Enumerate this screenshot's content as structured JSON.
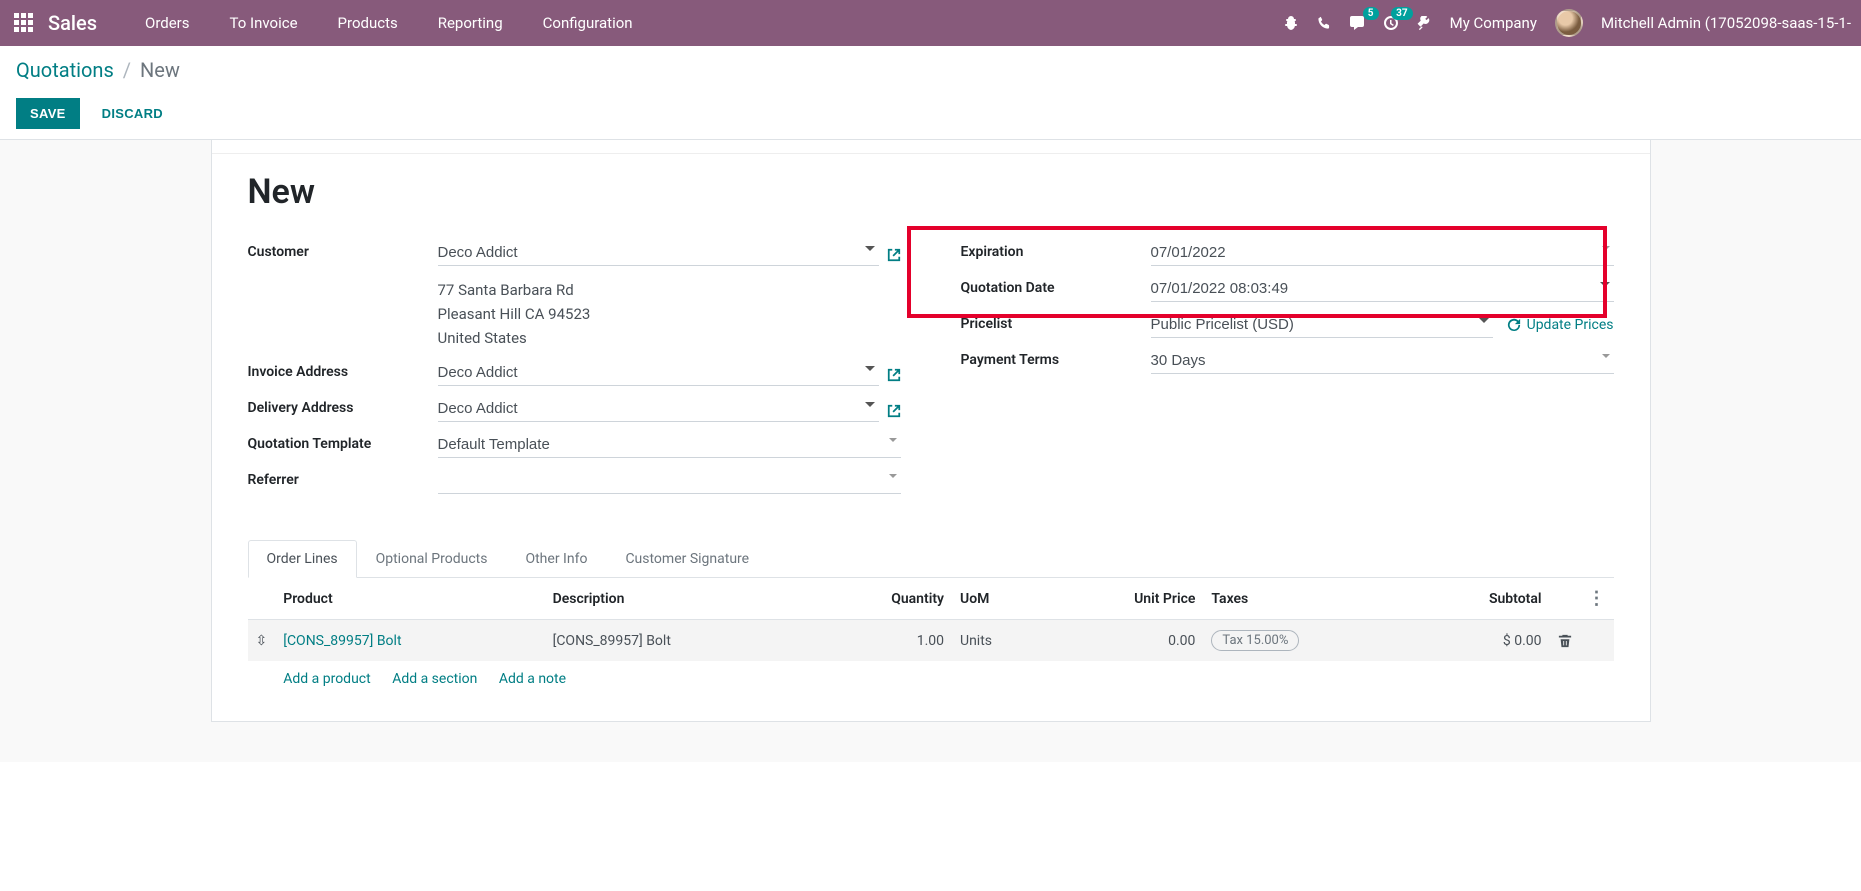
{
  "nav": {
    "brand": "Sales",
    "items": [
      "Orders",
      "To Invoice",
      "Products",
      "Reporting",
      "Configuration"
    ],
    "messaging_badge": "5",
    "activities_badge": "37",
    "company": "My Company",
    "user": "Mitchell Admin (17052098-saas-15-1-"
  },
  "breadcrumb": {
    "root": "Quotations",
    "current": "New"
  },
  "buttons": {
    "save": "SAVE",
    "discard": "DISCARD"
  },
  "title": "New",
  "left": {
    "customer_label": "Customer",
    "customer_value": "Deco Addict",
    "address_line1": "77 Santa Barbara Rd",
    "address_line2": "Pleasant Hill CA 94523",
    "address_line3": "United States",
    "invoice_label": "Invoice Address",
    "invoice_value": "Deco Addict",
    "delivery_label": "Delivery Address",
    "delivery_value": "Deco Addict",
    "template_label": "Quotation Template",
    "template_value": "Default Template",
    "referrer_label": "Referrer",
    "referrer_value": ""
  },
  "right": {
    "expiration_label": "Expiration",
    "expiration_value": "07/01/2022",
    "date_label": "Quotation Date",
    "date_value": "07/01/2022 08:03:49",
    "pricelist_label": "Pricelist",
    "pricelist_value": "Public Pricelist (USD)",
    "update_prices": "Update Prices",
    "terms_label": "Payment Terms",
    "terms_value": "30 Days"
  },
  "tabs": [
    "Order Lines",
    "Optional Products",
    "Other Info",
    "Customer Signature"
  ],
  "table": {
    "headers": {
      "product": "Product",
      "description": "Description",
      "quantity": "Quantity",
      "uom": "UoM",
      "unit_price": "Unit Price",
      "taxes": "Taxes",
      "subtotal": "Subtotal"
    },
    "rows": [
      {
        "product": "[CONS_89957] Bolt",
        "description": "[CONS_89957] Bolt",
        "quantity": "1.00",
        "uom": "Units",
        "unit_price": "0.00",
        "tax": "Tax 15.00%",
        "subtotal": "$ 0.00"
      }
    ],
    "add_product": "Add a product",
    "add_section": "Add a section",
    "add_note": "Add a note"
  }
}
